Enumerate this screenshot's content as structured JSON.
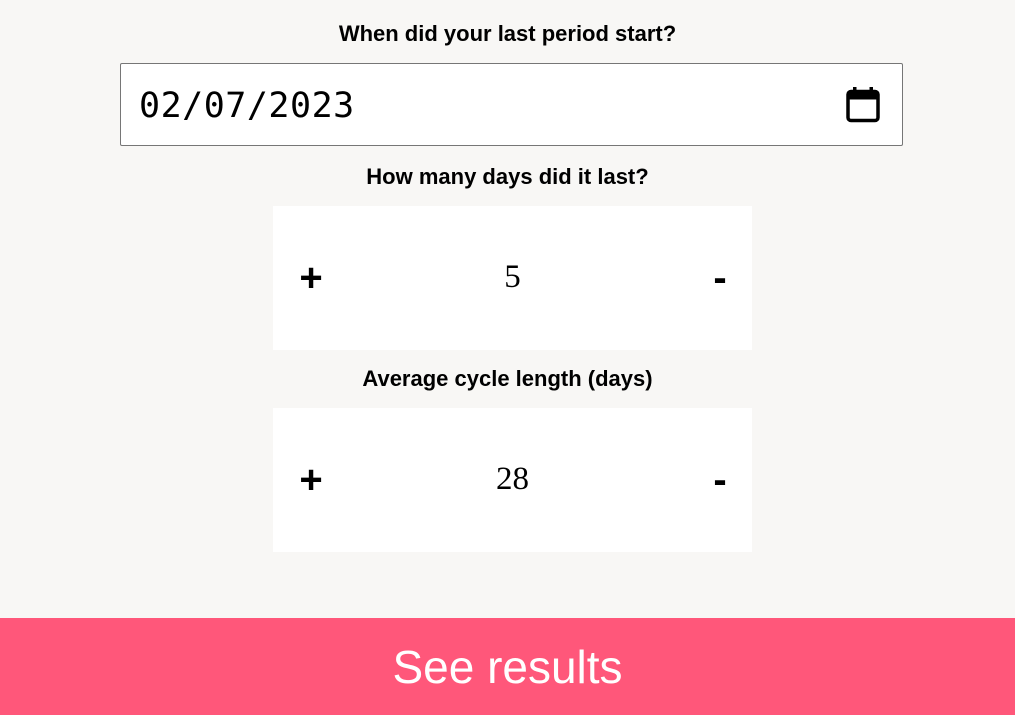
{
  "period_start": {
    "label": "When did your last period start?",
    "value": "02/07/2023",
    "icon": "calendar-icon"
  },
  "period_length": {
    "label": "How many days did it last?",
    "increment_label": "+",
    "decrement_label": "-",
    "value": "5"
  },
  "cycle_length": {
    "label": "Average cycle length (days)",
    "increment_label": "+",
    "decrement_label": "-",
    "value": "28"
  },
  "submit": {
    "label": "See results"
  },
  "colors": {
    "background": "#f8f7f5",
    "accent": "#ff577a",
    "panel": "#ffffff"
  }
}
